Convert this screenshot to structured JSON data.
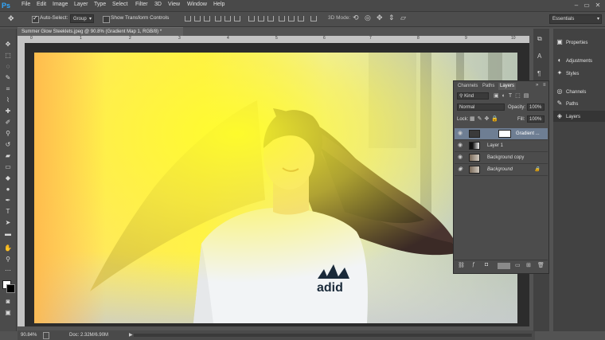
{
  "app": {
    "logo": "Ps",
    "menu": [
      "File",
      "Edit",
      "Image",
      "Layer",
      "Type",
      "Select",
      "Filter",
      "3D",
      "View",
      "Window",
      "Help"
    ],
    "window_controls": [
      "–",
      "▭",
      "✕"
    ]
  },
  "options_bar": {
    "auto_select_label": "Auto-Select:",
    "auto_select_value": "Group",
    "transform_label": "Show Transform Controls",
    "mode_label": "3D Mode:",
    "workspace": "Essentials"
  },
  "document": {
    "tab_title": "Summer Glow Steeklets.jpeg @ 90.8% (Gradient Map 1, RGB/8) *",
    "ruler_ticks": [
      "0",
      "1",
      "2",
      "3",
      "4",
      "5",
      "6",
      "7",
      "8",
      "9",
      "10"
    ],
    "zoom": "90.84%",
    "doc_size": "Doc: 2.32M/6.90M"
  },
  "right_panels": [
    {
      "label": "Properties",
      "icon": "properties-icon",
      "glyph": "▣"
    },
    {
      "label": "Adjustments",
      "icon": "adjustments-icon",
      "glyph": "◐"
    },
    {
      "label": "Styles",
      "icon": "styles-icon",
      "glyph": "✦"
    },
    {
      "label": "Channels",
      "icon": "channels-icon",
      "glyph": "◎"
    },
    {
      "label": "Paths",
      "icon": "paths-icon",
      "glyph": "✎"
    },
    {
      "label": "Layers",
      "icon": "layers-icon",
      "glyph": "◈"
    }
  ],
  "layers_panel": {
    "tabs": [
      "Channels",
      "Paths",
      "Layers"
    ],
    "kind": "Kind",
    "blend_mode": "Normal",
    "opacity_label": "Opacity:",
    "opacity_value": "100%",
    "lock_label": "Lock:",
    "fill_label": "Fill:",
    "fill_value": "100%",
    "layers": [
      {
        "name": "Gradient ...",
        "selected": true
      },
      {
        "name": "Layer 1",
        "selected": false
      },
      {
        "name": "Background copy",
        "selected": false
      },
      {
        "name": "Background",
        "selected": false
      }
    ]
  },
  "photo_overlay": {
    "logo_text": "adid"
  }
}
